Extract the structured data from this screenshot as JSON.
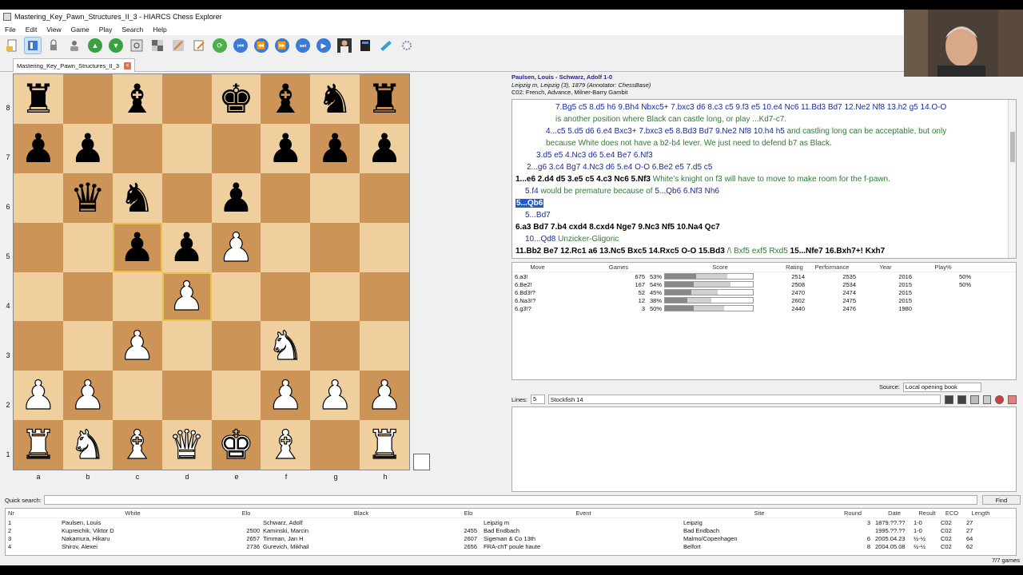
{
  "window": {
    "title": "Mastering_Key_Pawn_Structures_II_3 - HIARCS Chess Explorer"
  },
  "menu": [
    "File",
    "Edit",
    "View",
    "Game",
    "Play",
    "Search",
    "Help"
  ],
  "tab": {
    "label": "Mastering_Key_Pawn_Structures_II_3",
    "close": "×"
  },
  "board": {
    "ranks": [
      "8",
      "7",
      "6",
      "5",
      "4",
      "3",
      "2",
      "1"
    ],
    "files": [
      "a",
      "b",
      "c",
      "d",
      "e",
      "f",
      "g",
      "h"
    ],
    "rows": [
      [
        "r",
        "",
        "b",
        "",
        "k",
        "b",
        "n",
        "r"
      ],
      [
        "p",
        "p",
        "",
        "",
        "",
        "p",
        "p",
        "p"
      ],
      [
        "",
        "q",
        "n",
        "",
        "p",
        "",
        "",
        ""
      ],
      [
        "",
        "",
        "p",
        "p",
        "P",
        "",
        "",
        ""
      ],
      [
        "",
        "",
        "",
        "P",
        "",
        "",
        "",
        ""
      ],
      [
        "",
        "",
        "P",
        "",
        "",
        "N",
        "",
        ""
      ],
      [
        "P",
        "P",
        "",
        "",
        "",
        "P",
        "P",
        "P"
      ],
      [
        "R",
        "N",
        "B",
        "Q",
        "K",
        "B",
        "",
        "R"
      ]
    ],
    "highlight": [
      "c5",
      "d4"
    ]
  },
  "game": {
    "players": "Paulsen, Louis - Schwarz, Adolf  1-0",
    "event_line": "Leipzig m, Leipzig (3), 1879  (Annotator: ChessBase)",
    "opening": "C02: French, Advance, Milner-Barry Gambit"
  },
  "notation": [
    {
      "indent": 50,
      "parts": [
        {
          "c": "mv",
          "t": "7.Bg5 c5 8.d5 h6 9.Bh4 Nbxc5+ 7.bxc3 d6 8.c3 c5 9.f3 e5 10.e4 Nc6 11.Bd3 Bd7 12.Ne2 Nf8 13.h2 g5 14.O-O "
        }
      ]
    },
    {
      "indent": 50,
      "parts": [
        {
          "c": "cm",
          "t": "is another position where Black can castle long, or play ...Kd7-c7."
        }
      ]
    },
    {
      "indent": 38,
      "parts": [
        {
          "c": "mv",
          "t": "4...c5 5.d5 d6 6.e4 Bxc3+ 7.bxc3 e5 8.Bd3 Bd7 9.Ne2 Nf8 10.h4 h5 "
        },
        {
          "c": "cm",
          "t": "and castling long can be acceptable, but only"
        }
      ]
    },
    {
      "indent": 38,
      "parts": [
        {
          "c": "cm",
          "t": "because White does not have a b2-b4 lever. We just need to defend b7 as Black."
        }
      ]
    },
    {
      "indent": 26,
      "parts": [
        {
          "c": "mv",
          "t": "3.d5 e5 4.Nc3 d6 5.e4 Be7 6.Nf3"
        }
      ]
    },
    {
      "indent": 14,
      "parts": [
        {
          "c": "mv",
          "t": "2...g6 3.c4 Bg7 4.Nc3 d6 5.e4 O-O 6.Be2 e5 7.d5 c5"
        }
      ]
    },
    {
      "indent": 0,
      "parts": [
        {
          "c": "mn",
          "t": "1...e6 2.d4 d5 3.e5 c5 4.c3 Nc6 5.Nf3 "
        },
        {
          "c": "cm",
          "t": "White's knight on f3 will have to move to make room for the f-pawn."
        }
      ]
    },
    {
      "indent": 12,
      "parts": [
        {
          "c": "mv",
          "t": "5.f4 "
        },
        {
          "c": "cm",
          "t": "would be premature because of "
        },
        {
          "c": "mv",
          "t": "5...Qb6 6.Nf3 Nh6"
        }
      ]
    },
    {
      "indent": 0,
      "parts": [
        {
          "c": "cur",
          "t": "5...Qb6"
        }
      ]
    },
    {
      "indent": 12,
      "parts": [
        {
          "c": "mv",
          "t": "5...Bd7"
        }
      ]
    },
    {
      "indent": 0,
      "parts": [
        {
          "c": "mn",
          "t": "6.a3 Bd7 7.b4 cxd4 8.cxd4 Nge7 9.Nc3 Nf5 10.Na4 Qc7"
        }
      ]
    },
    {
      "indent": 12,
      "parts": [
        {
          "c": "mv",
          "t": "10...Qd8 "
        },
        {
          "c": "cm",
          "t": "Unzicker-Gligoric"
        }
      ]
    },
    {
      "indent": 0,
      "parts": [
        {
          "c": "mn",
          "t": "11.Bb2 Be7 12.Rc1 a6 13.Nc5 Bxc5 14.Rxc5 O-O 15.Bd3 "
        },
        {
          "c": "cm",
          "t": "/\\ Bxf5 exf5 Rxd5 "
        },
        {
          "c": "mn",
          "t": "15...Nfe7 16.Bxh7+! Kxh7"
        }
      ]
    }
  ],
  "tree": {
    "headers": {
      "move": "Move",
      "games": "Games",
      "score": "Score",
      "rating": "Rating",
      "performance": "Performance",
      "year": "Year",
      "play": "Play%"
    },
    "rows": [
      {
        "move": "6.a3!",
        "games": "675",
        "pct": "53%",
        "win": 0.35,
        "draw": 0.36,
        "rating": "2514",
        "perf": "2535",
        "year": "2016",
        "play": "50%"
      },
      {
        "move": "6.Be2!",
        "games": "167",
        "pct": "54%",
        "win": 0.33,
        "draw": 0.42,
        "rating": "2508",
        "perf": "2534",
        "year": "2015",
        "play": "50%"
      },
      {
        "move": "6.Bd3!?",
        "games": "52",
        "pct": "45%",
        "win": 0.3,
        "draw": 0.3,
        "rating": "2470",
        "perf": "2474",
        "year": "2015",
        "play": ""
      },
      {
        "move": "6.Na3!?",
        "games": "12",
        "pct": "38%",
        "win": 0.25,
        "draw": 0.28,
        "rating": "2602",
        "perf": "2475",
        "year": "2015",
        "play": ""
      },
      {
        "move": "6.g3!?",
        "games": "3",
        "pct": "50%",
        "win": 0.33,
        "draw": 0.34,
        "rating": "2440",
        "perf": "2476",
        "year": "1980",
        "play": ""
      }
    ]
  },
  "source": {
    "label": "Source:",
    "value": "Local opening book"
  },
  "engine": {
    "lines_label": "Lines:",
    "lines_value": "5",
    "name": "Stockfish 14"
  },
  "quick_search": {
    "label": "Quick search:",
    "find": "Find"
  },
  "games": {
    "headers": {
      "nr": "Nr",
      "white": "White",
      "welo": "Elo",
      "black": "Black",
      "belo": "Elo",
      "event": "Event",
      "site": "Site",
      "round": "Round",
      "date": "Date",
      "result": "Result",
      "eco": "ECO",
      "length": "Length"
    },
    "rows": [
      {
        "nr": "1",
        "white": "Paulsen, Louis",
        "welo": "",
        "black": "Schwarz, Adolf",
        "belo": "",
        "event": "Leipzig m",
        "site": "Leipzig",
        "round": "3",
        "date": "1879.??.??",
        "result": "1-0",
        "eco": "C02",
        "length": "27"
      },
      {
        "nr": "2",
        "white": "Kupreichik, Viktor D",
        "welo": "2500",
        "black": "Kaminski, Marcin",
        "belo": "2455",
        "event": "Bad Endbach",
        "site": "Bad Endbach",
        "round": "",
        "date": "1995.??.??",
        "result": "1-0",
        "eco": "C02",
        "length": "27"
      },
      {
        "nr": "3",
        "white": "Nakamura, Hikaru",
        "welo": "2657",
        "black": "Timman, Jan H",
        "belo": "2607",
        "event": "Sigeman & Co 13th",
        "site": "Malmo/Copenhagen",
        "round": "6",
        "date": "2005.04.23",
        "result": "½-½",
        "eco": "C02",
        "length": "64"
      },
      {
        "nr": "4",
        "white": "Shirov, Alexei",
        "welo": "2736",
        "black": "Gurevich, Mikhail",
        "belo": "2656",
        "event": "FRA-chT poule haute",
        "site": "Belfort",
        "round": "8",
        "date": "2004.05.08",
        "result": "½-½",
        "eco": "C02",
        "length": "62"
      }
    ]
  },
  "status": {
    "count": "7/7 games"
  },
  "colors": {
    "light_square": "#f0cf9e",
    "dark_square": "#cd9457",
    "highlight": "#e8c24a",
    "move_text": "#1a2aa0",
    "comment_text": "#2e7d32",
    "current_move": "#1a5bd8"
  }
}
